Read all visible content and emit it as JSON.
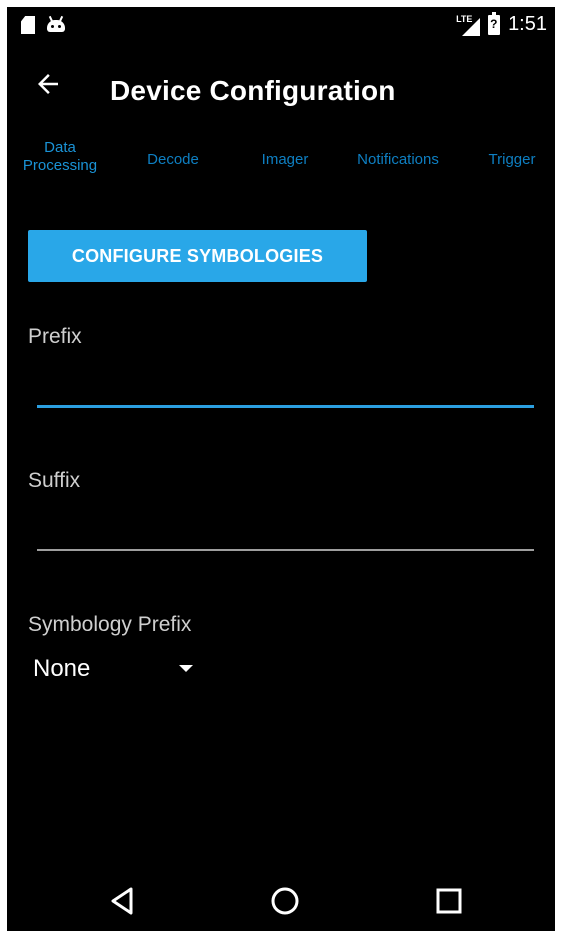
{
  "status_bar": {
    "time": "1:51",
    "network": "LTE",
    "icons": [
      "sd-card-icon",
      "android-icon",
      "lte-signal-icon",
      "battery-icon"
    ]
  },
  "app_bar": {
    "title": "Device Configuration",
    "back_icon": "arrow-back-icon"
  },
  "tabs": [
    {
      "line1": "Data",
      "line2": "Processing",
      "active": true
    },
    {
      "line1": "Decode",
      "line2": "",
      "active": false
    },
    {
      "line1": "Imager",
      "line2": "",
      "active": false
    },
    {
      "line1": "Notifications",
      "line2": "",
      "active": false
    },
    {
      "line1": "Trigger",
      "line2": "",
      "active": false
    }
  ],
  "configure_button": {
    "label": "CONFIGURE SYMBOLOGIES"
  },
  "prefix": {
    "label": "Prefix",
    "value": "",
    "focused": true
  },
  "suffix": {
    "label": "Suffix",
    "value": "",
    "focused": false
  },
  "symbology_prefix": {
    "label": "Symbology Prefix",
    "selected": "None"
  },
  "nav_bar": {
    "icons": [
      "back-triangle-icon",
      "home-circle-icon",
      "recents-square-icon"
    ]
  },
  "colors": {
    "accent": "#29a7e8",
    "tab_text": "#0e7fc2",
    "focused_line": "#2b9fe0",
    "background": "#000000"
  }
}
